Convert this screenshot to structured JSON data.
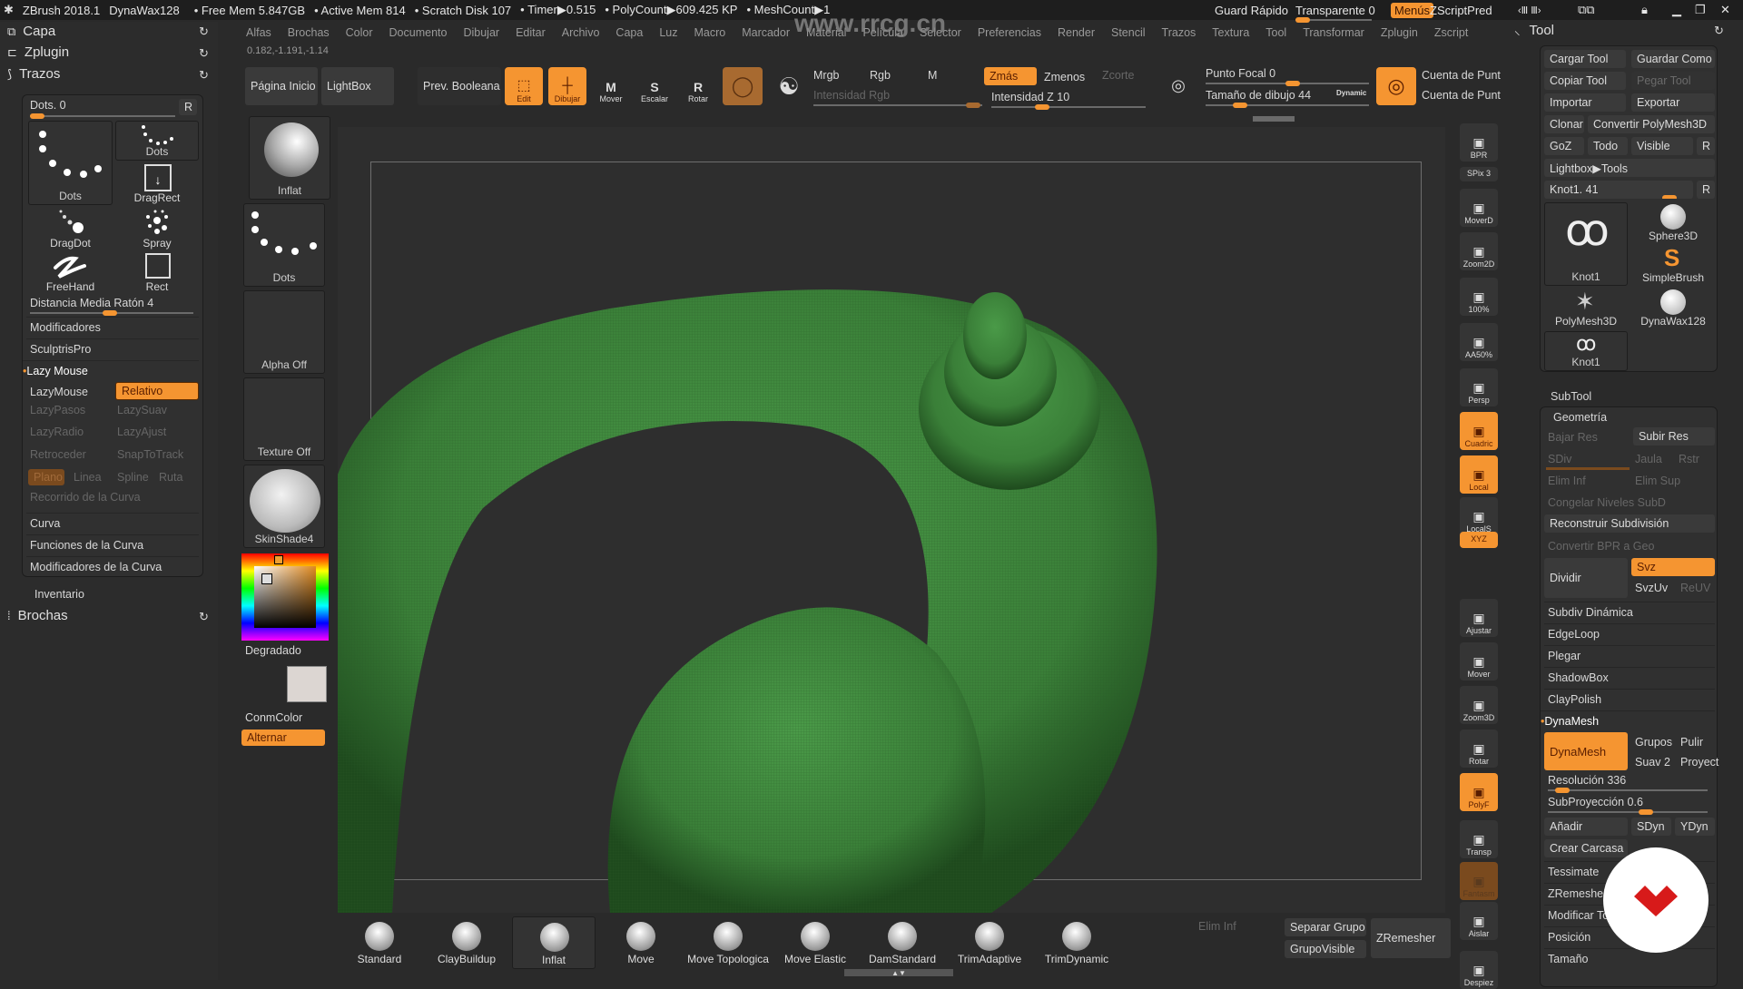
{
  "titlebar": {
    "app": "ZBrush 2018.1",
    "tool": "DynaWax128",
    "free_mem": "• Free Mem 5.847GB",
    "active_mem": "• Active Mem 814",
    "scratch": "• Scratch Disk 107",
    "timer": "• Timer▶0.515",
    "polycount": "• PolyCount▶609.425 KP",
    "meshcount": "• MeshCount▶1",
    "guard": "Guard Rápido",
    "transparent": "Transparente 0",
    "transparent_value": 0,
    "menus": "Menús",
    "zscript": "ZScriptPred"
  },
  "menubar": [
    "Alfas",
    "Brochas",
    "Color",
    "Documento",
    "Dibujar",
    "Editar",
    "Archivo",
    "Capa",
    "Luz",
    "Macro",
    "Marcador",
    "Material",
    "Película",
    "Selector",
    "Preferencias",
    "Render",
    "Stencil",
    "Trazos",
    "Textura",
    "Tool",
    "Transformar",
    "Zplugin",
    "Zscript"
  ],
  "coords": "0.182,-1.191,-1.14",
  "left_tray": {
    "headers": {
      "capa": "Capa",
      "zplugin": "Zplugin",
      "trazos": "Trazos",
      "brochas": "Brochas"
    },
    "dots_slider": "Dots. 0",
    "r": "R",
    "strokes": [
      {
        "name": "Dots",
        "icon": "dots-stroke-icon"
      },
      {
        "name": "Dots",
        "icon": "dots-stroke-icon"
      },
      {
        "name": "DragRect",
        "icon": "dragrect-icon"
      },
      {
        "name": "DragDot",
        "icon": "dragdot-icon"
      },
      {
        "name": "Spray",
        "icon": "spray-icon"
      },
      {
        "name": "FreeHand",
        "icon": "freehand-icon"
      },
      {
        "name": "Rect",
        "icon": "rect-icon"
      }
    ],
    "distancia": "Distancia Media Ratón 4",
    "modificadores": "Modificadores",
    "sculptris": "SculptrisPro",
    "lazy_mouse": "Lazy Mouse",
    "lazymouse_btn": "LazyMouse",
    "relativo": "Relativo",
    "lazypasos": "LazyPasos",
    "lazysuav": "LazySuav",
    "lazyradio": "LazyRadio",
    "lazyajust": "LazyAjust",
    "retroceder": "Retroceder",
    "snaptotrack": "SnapToTrack",
    "modes": [
      "Plano",
      "Linea",
      "Spline",
      "Ruta"
    ],
    "recorrido": "Recorrido de la Curva",
    "curva": "Curva",
    "funciones": "Funciones de la Curva",
    "modcurva": "Modificadores de la Curva",
    "inventario": "Inventario"
  },
  "shelf": {
    "pagina": "Página Inicio",
    "lightbox": "LightBox",
    "boolean": "Prev. Booleana",
    "edit": "Edit",
    "dibujar": "Dibujar",
    "mover": "Mover",
    "escalar": "Escalar",
    "rotar": "Rotar",
    "mrgb": "Mrgb",
    "rgb": "Rgb",
    "m": "M",
    "intensidad_rgb": "Intensidad Rgb",
    "zmas": "Zmás",
    "zmenos": "Zmenos",
    "zcorte": "Zcorte",
    "intensidad_z": "Intensidad Z 10",
    "punto_focal": "Punto Focal 0",
    "tamano": "Tamaño de dibujo 44",
    "dynamic": "Dynamic",
    "cuenta1": "Cuenta de Punt",
    "cuenta2": "Cuenta de Punt"
  },
  "left_shelf": {
    "brush": "Inflat",
    "stroke": "Dots",
    "alpha": "Alpha Off",
    "texture": "Texture Off",
    "material": "SkinShade4",
    "gradient": "Degradado",
    "conmcolor": "ConmColor",
    "alternar": "Alternar"
  },
  "right_shelf": [
    {
      "label": "BPR",
      "on": false
    },
    {
      "label": "SPix 3",
      "on": false
    },
    {
      "label": "MoverD",
      "on": false
    },
    {
      "label": "Zoom2D",
      "on": false
    },
    {
      "label": "100%",
      "on": false
    },
    {
      "label": "AA50%",
      "on": false
    },
    {
      "label": "Persp",
      "on": false
    },
    {
      "label": "Cuadric",
      "on": true
    },
    {
      "label": "Local",
      "on": true
    },
    {
      "label": "LocalS",
      "on": false
    },
    {
      "label": "XYZ",
      "on": true
    },
    {
      "label": "Ajustar",
      "on": false
    },
    {
      "label": "Mover",
      "on": false
    },
    {
      "label": "Zoom3D",
      "on": false
    },
    {
      "label": "Rotar",
      "on": false
    },
    {
      "label": "PolyF",
      "on": true
    },
    {
      "label": "Transp",
      "on": false
    },
    {
      "label": "Fantasm",
      "on": false
    },
    {
      "label": "Aislar",
      "on": false
    },
    {
      "label": "Despiez",
      "on": false
    }
  ],
  "tool_panel": {
    "title": "Tool",
    "cargar": "Cargar Tool",
    "guardar": "Guardar Como",
    "copiar": "Copiar Tool",
    "pegar": "Pegar Tool",
    "importar": "Importar",
    "exportar": "Exportar",
    "clonar": "Clonar",
    "convertir": "Convertir PolyMesh3D",
    "goz": "GoZ",
    "todo": "Todo",
    "visible": "Visible",
    "r": "R",
    "lightbox_tools": "Lightbox▶Tools",
    "knot_slider": "Knot1. 41",
    "tools": [
      {
        "name": "Knot1"
      },
      {
        "name": "Sphere3D"
      },
      {
        "name": "SimpleBrush"
      },
      {
        "name": "PolyMesh3D"
      },
      {
        "name": "DynaWax128"
      },
      {
        "name": "Knot1"
      }
    ],
    "subtool": "SubTool",
    "geometria": "Geometría",
    "bajar_res": "Bajar Res",
    "subir_res": "Subir Res",
    "sdiv": "SDiv",
    "jaula": "Jaula",
    "rstr": "Rstr",
    "elim_inf": "Elim Inf",
    "elim_sup": "Elim Sup",
    "congelar": "Congelar Niveles SubD",
    "reconstruir": "Reconstruir Subdivisión",
    "convertir_bpr": "Convertir BPR a Geo",
    "dividir": "Dividir",
    "svz": "Svz",
    "svzuv": "SvzUv",
    "reuv": "ReUV",
    "subdiv_din": "Subdiv Dinámica",
    "edgeloop": "EdgeLoop",
    "plegar": "Plegar",
    "shadowbox": "ShadowBox",
    "claypolish": "ClayPolish",
    "dynamesh_section": "DynaMesh",
    "dynamesh_btn": "DynaMesh",
    "grupos": "Grupos",
    "pulir": "Pulir",
    "suav": "Suav 2",
    "proyect": "Proyect",
    "resolucion": "Resolución 336",
    "subproyeccion": "SubProyección 0.6",
    "anadir": "Añadir",
    "sdyn": "SDyn",
    "ydyn": "YDyn",
    "crear_carcasa": "Crear Carcasa",
    "tessimate": "Tessimate",
    "zremesher": "ZRemesher",
    "modificar": "Modificar Topología",
    "posicion": "Posición",
    "tamano": "Tamaño"
  },
  "brush_shelf": [
    "Standard",
    "ClayBuildup",
    "Inflat",
    "Move",
    "Move Topologica",
    "Move Elastic",
    "DamStandard",
    "TrimAdaptive",
    "TrimDynamic"
  ],
  "bottom_right": {
    "elim_inf": "Elim Inf",
    "separar": "Separar Grupo",
    "grupovisible": "GrupoVisible",
    "zremesher": "ZRemesher"
  },
  "watermark": "www.rrcg.cn",
  "colors": {
    "accent": "#f59531",
    "mesh": "#3f8a3e",
    "bg": "#2a2a2a"
  }
}
